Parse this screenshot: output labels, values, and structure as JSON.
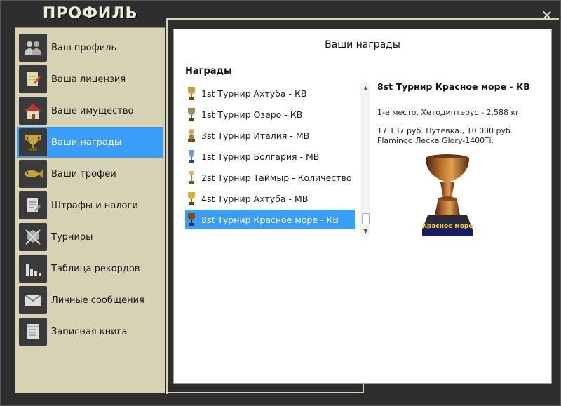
{
  "window": {
    "title": "ПРОФИЛЬ",
    "close_label": "✕"
  },
  "sidebar": {
    "items": [
      {
        "label": "Ваш профиль",
        "icon": "users-icon"
      },
      {
        "label": "Ваша лицензия",
        "icon": "license-icon"
      },
      {
        "label": "Ваше имущество",
        "icon": "house-icon"
      },
      {
        "label": "Ваши награды",
        "icon": "trophy-icon",
        "active": true
      },
      {
        "label": "Ваши трофеи",
        "icon": "fish-icon"
      },
      {
        "label": "Штрафы и налоги",
        "icon": "fines-icon"
      },
      {
        "label": "Турниры",
        "icon": "tournament-icon"
      },
      {
        "label": "Таблица рекордов",
        "icon": "chart-icon"
      },
      {
        "label": "Личные сообщения",
        "icon": "envelope-icon"
      },
      {
        "label": "Записная книга",
        "icon": "notebook-icon"
      }
    ]
  },
  "panel": {
    "title": "Ваши награды",
    "section_title": "Награды",
    "awards": [
      {
        "label": "1st Турнир Ахтуба - КВ"
      },
      {
        "label": "1st Турнир Озеро - КВ"
      },
      {
        "label": "3st Турнир Италия - МВ"
      },
      {
        "label": "1st Турнир Болгария - МВ"
      },
      {
        "label": "2st Турнир Таймыр - Количество"
      },
      {
        "label": "4st Турнир Ахтуба - МВ"
      },
      {
        "label": "8st Турнир Красное море - КВ",
        "selected": true
      }
    ],
    "detail": {
      "title": "8st Турнир Красное море - КВ",
      "place": "1-е место, Хетодиптерус - 2,588 кг",
      "prize": "17 137 руб. Путевка., 10 000 руб. Flamingo Леска Glory-1400Ti.",
      "trophy_plate_text": "Красное море"
    }
  },
  "colors": {
    "accent": "#3a9df7",
    "sidebar_bg": "#d6d2b3",
    "frame_bg": "#2e2e2e"
  }
}
